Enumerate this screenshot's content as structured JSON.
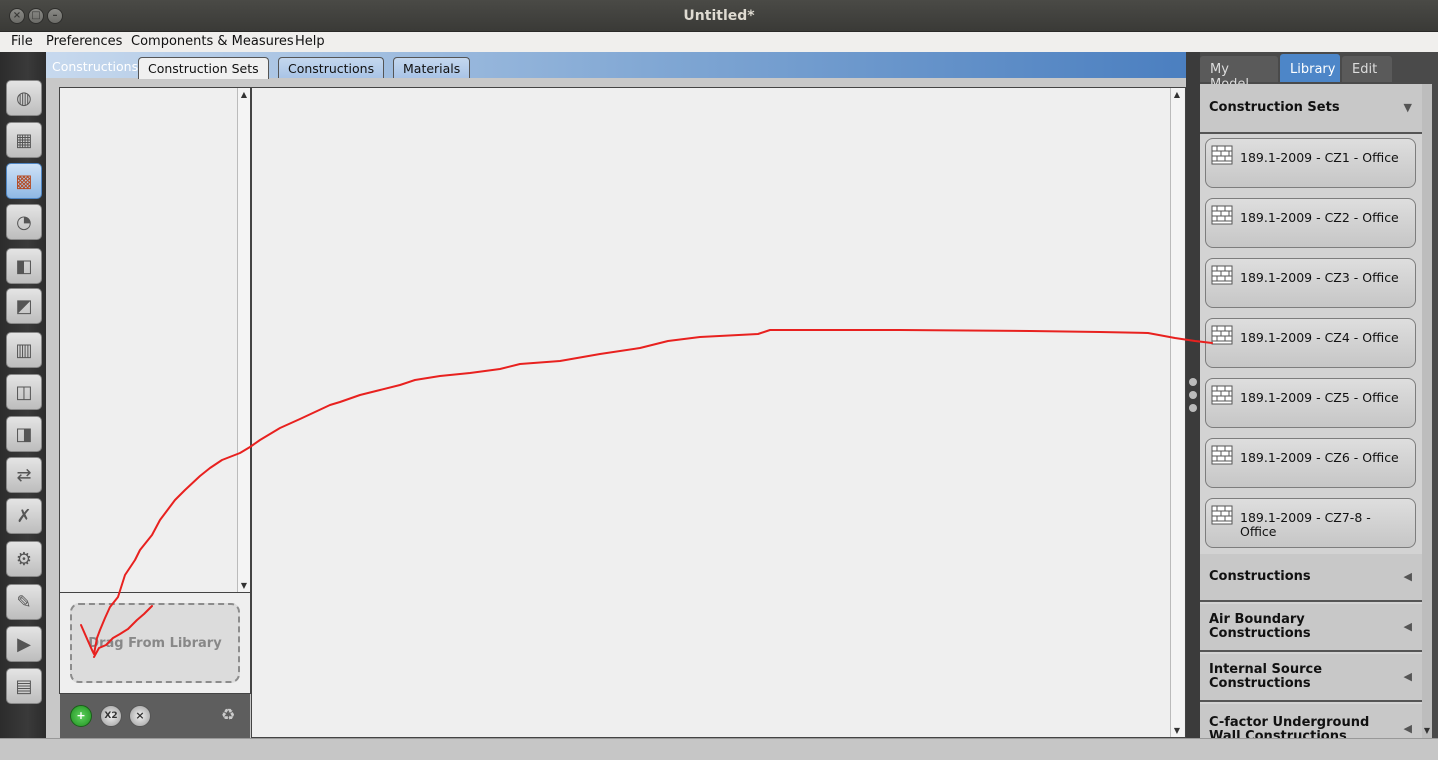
{
  "window": {
    "title": "Untitled*",
    "close_glyph": "×",
    "minimize_glyph": "–",
    "maximize_glyph": "□"
  },
  "menu": [
    "File",
    "Preferences",
    "Components & Measures",
    "Help"
  ],
  "leftnav": {
    "icons": [
      "globe-icon",
      "calendar-icon",
      "construction-brick-icon",
      "loads-plug-icon",
      "space-types-icon",
      "geometry-icon",
      "facility-icon",
      "spaces-icon",
      "thermal-zones-icon",
      "hvac-icon",
      "output-variables-icon",
      "simulation-settings-icon",
      "scripts-icon",
      "run-simulation-icon",
      "results-icon"
    ],
    "active_index": 2
  },
  "center": {
    "breadcrumb": "Constructions",
    "tabs": [
      "Construction Sets",
      "Constructions",
      "Materials"
    ],
    "active_tab": 0,
    "drop_zone": "Drag From Library",
    "toolbar": {
      "add_glyph": "+",
      "copy_glyph": "X2",
      "remove_glyph": "×",
      "purge_glyph": "♻"
    }
  },
  "right": {
    "tabs": [
      "My Model",
      "Library",
      "Edit"
    ],
    "active_tab": 1,
    "sections": [
      {
        "title": "Construction Sets",
        "expanded": true,
        "arrow": "▼",
        "items": [
          "189.1-2009 - CZ1 - Office",
          "189.1-2009 - CZ2 - Office",
          "189.1-2009 - CZ3 - Office",
          "189.1-2009 - CZ4 - Office",
          "189.1-2009 - CZ5 - Office",
          "189.1-2009 - CZ6 - Office",
          "189.1-2009 - CZ7-8 - Office"
        ]
      },
      {
        "title": "Constructions",
        "expanded": false,
        "arrow": "◀"
      },
      {
        "title": "Air Boundary Constructions",
        "expanded": false,
        "arrow": "◀"
      },
      {
        "title": "Internal Source Constructions",
        "expanded": false,
        "arrow": "◀"
      },
      {
        "title": "C-factor Underground Wall Constructions",
        "expanded": false,
        "arrow": "◀"
      }
    ]
  },
  "colors": {
    "accent": "#4d86c8",
    "annotation": "#e8211f",
    "nav_active": "#8fb8e4"
  }
}
